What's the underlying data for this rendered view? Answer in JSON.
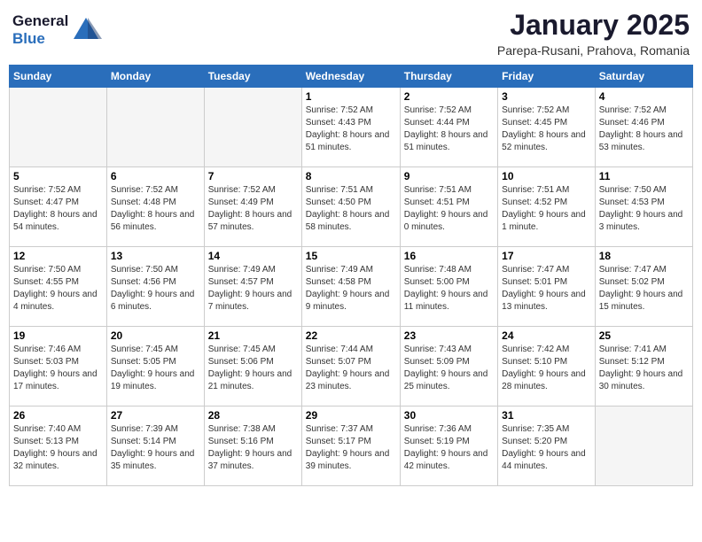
{
  "header": {
    "logo_general": "General",
    "logo_blue": "Blue",
    "title": "January 2025",
    "subtitle": "Parepa-Rusani, Prahova, Romania"
  },
  "weekdays": [
    "Sunday",
    "Monday",
    "Tuesday",
    "Wednesday",
    "Thursday",
    "Friday",
    "Saturday"
  ],
  "weeks": [
    [
      {
        "day": "",
        "info": ""
      },
      {
        "day": "",
        "info": ""
      },
      {
        "day": "",
        "info": ""
      },
      {
        "day": "1",
        "info": "Sunrise: 7:52 AM\nSunset: 4:43 PM\nDaylight: 8 hours and 51 minutes."
      },
      {
        "day": "2",
        "info": "Sunrise: 7:52 AM\nSunset: 4:44 PM\nDaylight: 8 hours and 51 minutes."
      },
      {
        "day": "3",
        "info": "Sunrise: 7:52 AM\nSunset: 4:45 PM\nDaylight: 8 hours and 52 minutes."
      },
      {
        "day": "4",
        "info": "Sunrise: 7:52 AM\nSunset: 4:46 PM\nDaylight: 8 hours and 53 minutes."
      }
    ],
    [
      {
        "day": "5",
        "info": "Sunrise: 7:52 AM\nSunset: 4:47 PM\nDaylight: 8 hours and 54 minutes."
      },
      {
        "day": "6",
        "info": "Sunrise: 7:52 AM\nSunset: 4:48 PM\nDaylight: 8 hours and 56 minutes."
      },
      {
        "day": "7",
        "info": "Sunrise: 7:52 AM\nSunset: 4:49 PM\nDaylight: 8 hours and 57 minutes."
      },
      {
        "day": "8",
        "info": "Sunrise: 7:51 AM\nSunset: 4:50 PM\nDaylight: 8 hours and 58 minutes."
      },
      {
        "day": "9",
        "info": "Sunrise: 7:51 AM\nSunset: 4:51 PM\nDaylight: 9 hours and 0 minutes."
      },
      {
        "day": "10",
        "info": "Sunrise: 7:51 AM\nSunset: 4:52 PM\nDaylight: 9 hours and 1 minute."
      },
      {
        "day": "11",
        "info": "Sunrise: 7:50 AM\nSunset: 4:53 PM\nDaylight: 9 hours and 3 minutes."
      }
    ],
    [
      {
        "day": "12",
        "info": "Sunrise: 7:50 AM\nSunset: 4:55 PM\nDaylight: 9 hours and 4 minutes."
      },
      {
        "day": "13",
        "info": "Sunrise: 7:50 AM\nSunset: 4:56 PM\nDaylight: 9 hours and 6 minutes."
      },
      {
        "day": "14",
        "info": "Sunrise: 7:49 AM\nSunset: 4:57 PM\nDaylight: 9 hours and 7 minutes."
      },
      {
        "day": "15",
        "info": "Sunrise: 7:49 AM\nSunset: 4:58 PM\nDaylight: 9 hours and 9 minutes."
      },
      {
        "day": "16",
        "info": "Sunrise: 7:48 AM\nSunset: 5:00 PM\nDaylight: 9 hours and 11 minutes."
      },
      {
        "day": "17",
        "info": "Sunrise: 7:47 AM\nSunset: 5:01 PM\nDaylight: 9 hours and 13 minutes."
      },
      {
        "day": "18",
        "info": "Sunrise: 7:47 AM\nSunset: 5:02 PM\nDaylight: 9 hours and 15 minutes."
      }
    ],
    [
      {
        "day": "19",
        "info": "Sunrise: 7:46 AM\nSunset: 5:03 PM\nDaylight: 9 hours and 17 minutes."
      },
      {
        "day": "20",
        "info": "Sunrise: 7:45 AM\nSunset: 5:05 PM\nDaylight: 9 hours and 19 minutes."
      },
      {
        "day": "21",
        "info": "Sunrise: 7:45 AM\nSunset: 5:06 PM\nDaylight: 9 hours and 21 minutes."
      },
      {
        "day": "22",
        "info": "Sunrise: 7:44 AM\nSunset: 5:07 PM\nDaylight: 9 hours and 23 minutes."
      },
      {
        "day": "23",
        "info": "Sunrise: 7:43 AM\nSunset: 5:09 PM\nDaylight: 9 hours and 25 minutes."
      },
      {
        "day": "24",
        "info": "Sunrise: 7:42 AM\nSunset: 5:10 PM\nDaylight: 9 hours and 28 minutes."
      },
      {
        "day": "25",
        "info": "Sunrise: 7:41 AM\nSunset: 5:12 PM\nDaylight: 9 hours and 30 minutes."
      }
    ],
    [
      {
        "day": "26",
        "info": "Sunrise: 7:40 AM\nSunset: 5:13 PM\nDaylight: 9 hours and 32 minutes."
      },
      {
        "day": "27",
        "info": "Sunrise: 7:39 AM\nSunset: 5:14 PM\nDaylight: 9 hours and 35 minutes."
      },
      {
        "day": "28",
        "info": "Sunrise: 7:38 AM\nSunset: 5:16 PM\nDaylight: 9 hours and 37 minutes."
      },
      {
        "day": "29",
        "info": "Sunrise: 7:37 AM\nSunset: 5:17 PM\nDaylight: 9 hours and 39 minutes."
      },
      {
        "day": "30",
        "info": "Sunrise: 7:36 AM\nSunset: 5:19 PM\nDaylight: 9 hours and 42 minutes."
      },
      {
        "day": "31",
        "info": "Sunrise: 7:35 AM\nSunset: 5:20 PM\nDaylight: 9 hours and 44 minutes."
      },
      {
        "day": "",
        "info": ""
      }
    ]
  ]
}
